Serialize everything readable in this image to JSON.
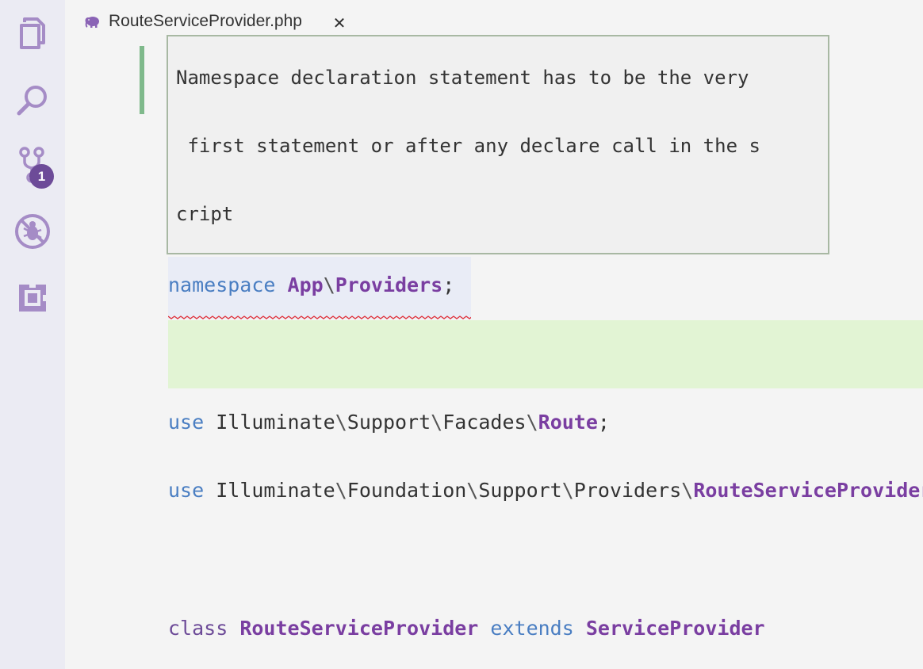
{
  "activity_bar": {
    "items": [
      {
        "name": "explorer",
        "icon": "files-icon"
      },
      {
        "name": "search",
        "icon": "search-icon"
      },
      {
        "name": "source-control",
        "icon": "source-control-icon",
        "badge": "1"
      },
      {
        "name": "debug",
        "icon": "no-bug-icon"
      },
      {
        "name": "extensions",
        "icon": "extensions-icon"
      }
    ],
    "accent_color": "#a58cc6"
  },
  "tab": {
    "label": "RouteServiceProvider.php",
    "icon": "php-elephant-icon",
    "close_glyph": "✕"
  },
  "hover": {
    "lines": [
      "Namespace declaration statement has to be the very",
      " first statement or after any declare call in the s",
      "cript"
    ]
  },
  "code": {
    "line1": {
      "kw": "namespace",
      "ns1": "App",
      "sep": "\\",
      "ns2": "Providers",
      "end": ";"
    },
    "line2": {
      "kw": "use",
      "p1": "Illuminate",
      "s1": "\\",
      "p2": "Support",
      "s2": "\\",
      "p3": "Facades",
      "s3": "\\",
      "cls": "Route",
      "end": ";"
    },
    "line3": {
      "kw": "use",
      "p1": "Illuminate",
      "s1": "\\",
      "p2": "Foundation",
      "s2": "\\",
      "p3": "Support",
      "s3": "\\",
      "p4": "Providers",
      "s4": "\\",
      "cls": "RouteServiceProvider",
      "end": ";"
    },
    "line4": {
      "kw": "class",
      "cls": "RouteServiceProvider",
      "kw2": "extends",
      "parent": "ServiceProvider"
    }
  },
  "colors": {
    "keyword": "#4a7ec2",
    "type": "#7a3ea1",
    "added_line": "#e2f4d4",
    "error_squiggle": "#e0303a"
  }
}
